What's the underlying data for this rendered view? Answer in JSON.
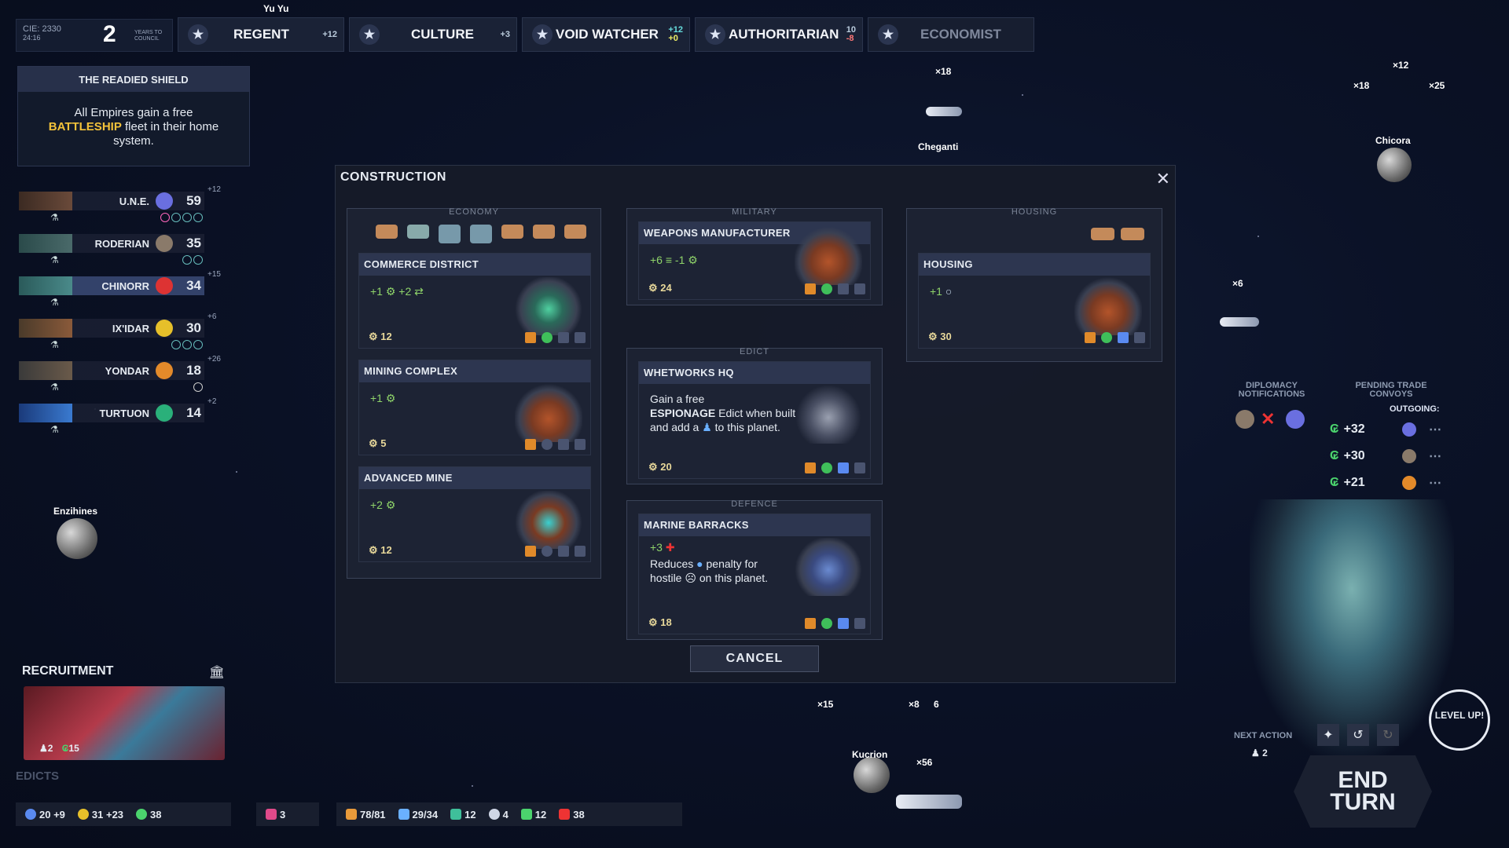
{
  "top": {
    "cie_label": "CIE: 2330",
    "cie_sub": "24:16",
    "years_value": "2",
    "years_label": "YEARS TO COUNCIL",
    "victories": [
      {
        "label": "REGENT",
        "bonus": "+12"
      },
      {
        "label": "CULTURE",
        "bonus": "+3"
      },
      {
        "label": "VOID WATCHER",
        "bonus": "+12",
        "bonus2": "+0"
      },
      {
        "label": "AUTHORITARIAN",
        "bonus": "10",
        "bonus2": "-8"
      },
      {
        "label": "ECONOMIST",
        "bonus": ""
      }
    ],
    "top_player": "Yu Yu"
  },
  "shield": {
    "title": "THE READIED SHIELD",
    "text_a": "All Empires gain a free",
    "text_b": "BATTLESHIP",
    "text_c": "fleet in their home system."
  },
  "empires": [
    {
      "name": "U.N.E.",
      "score": "59",
      "extra": "+12"
    },
    {
      "name": "RODERIAN",
      "score": "35",
      "extra": ""
    },
    {
      "name": "CHINORR",
      "score": "34",
      "extra": "+15"
    },
    {
      "name": "IX'IDAR",
      "score": "30",
      "extra": "+6"
    },
    {
      "name": "YONDAR",
      "score": "18",
      "extra": "+26"
    },
    {
      "name": "TURTUON",
      "score": "14",
      "extra": "+2"
    }
  ],
  "construction": {
    "title": "CONSTRUCTION",
    "cancel": "CANCEL",
    "sections": {
      "economy": "ECONOMY",
      "military": "MILITARY",
      "housing": "HOUSING",
      "edict": "EDICT",
      "defence": "DEFENCE"
    },
    "cards": {
      "commerce": {
        "title": "COMMERCE DISTRICT",
        "effect": "+1 ⚙ +2 ⇄",
        "cost": "12"
      },
      "mining": {
        "title": "MINING COMPLEX",
        "effect": "+1 ⚙",
        "cost": "5"
      },
      "adv_mine": {
        "title": "ADVANCED MINE",
        "effect": "+2 ⚙",
        "cost": "12"
      },
      "weapons": {
        "title": "WEAPONS MANUFACTURER",
        "effect": "+6 ≡ -1 ⚙",
        "cost": "24"
      },
      "whetworks": {
        "title": "WHETWORKS HQ",
        "desc_a": "Gain a free",
        "desc_b": "ESPIONAGE",
        "desc_c": "Edict when built and add a",
        "desc_d": "to this planet.",
        "cost": "20"
      },
      "marine": {
        "title": "MARINE BARRACKS",
        "effect": "+3",
        "desc_a": "Reduces",
        "desc_b": "penalty for hostile",
        "desc_c": "on this planet.",
        "cost": "18"
      },
      "housing": {
        "title": "HOUSING",
        "effect": "+1",
        "cost": "30"
      }
    }
  },
  "map": {
    "cheganti": "Cheganti",
    "chicora": "Chicora",
    "enzihines": "Enzihines",
    "kucrion": "Kucrion",
    "x18a": "×18",
    "x12": "×12",
    "x18b": "×18",
    "x25": "×25",
    "x6": "×6",
    "x15": "×15",
    "x8": "×8",
    "x6b": "6",
    "x56": "×56"
  },
  "right": {
    "diplomacy": "DIPLOMACY NOTIFICATIONS",
    "pending": "PENDING TRADE CONVOYS",
    "outgoing": "OUTGOING:",
    "trades": [
      "+32",
      "+30",
      "+21"
    ],
    "next_action": "NEXT ACTION",
    "next_count": "2",
    "level_up": "LEVEL UP!",
    "end_turn_a": "END",
    "end_turn_b": "TURN"
  },
  "recruitment": {
    "title": "RECRUITMENT",
    "count_a": "2",
    "count_b": "15",
    "edicts": "EDICTS"
  },
  "resources": [
    {
      "v": "20 +9"
    },
    {
      "v": "31 +23"
    },
    {
      "v": "38"
    },
    {
      "v": "3"
    },
    {
      "v": "78/81"
    },
    {
      "v": "29/34"
    },
    {
      "v": "12"
    },
    {
      "v": "4"
    },
    {
      "v": "12"
    },
    {
      "v": "38"
    }
  ]
}
